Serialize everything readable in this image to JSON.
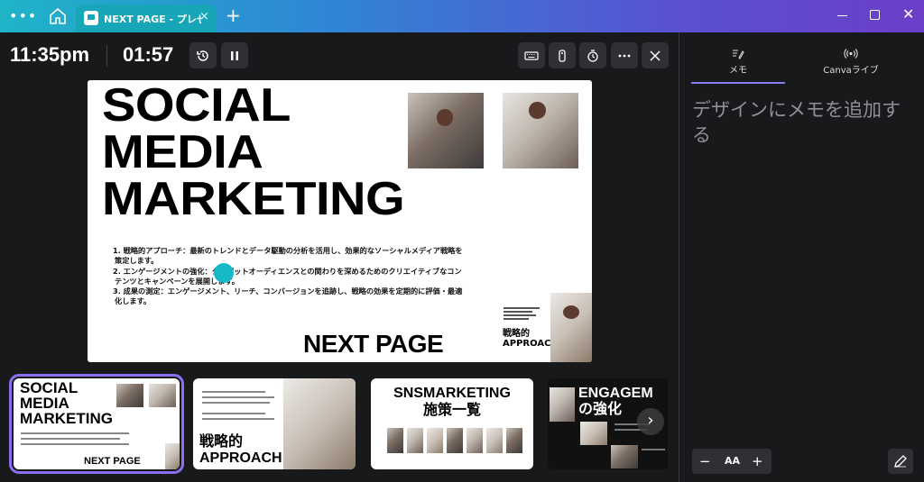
{
  "titlebar": {
    "tab_title": "NEXT PAGE - プレゼン",
    "tab_close": "×",
    "new_tab": "+",
    "more": "•••",
    "close": "✕"
  },
  "presenter": {
    "clock": "11:35pm",
    "timer": "01:57"
  },
  "slide": {
    "title_lines": [
      "SOCIAL",
      "MEDIA",
      "MARKETING"
    ],
    "list": [
      "1. 戦略的アプローチ：最新のトレンドとデータ駆動の分析を活用し、効果的なソーシャルメディア戦略を",
      "策定します。",
      "2. エンゲージメントの強化：ターゲットオーディエンスとの関わりを深めるためのクリエイティブなコン",
      "テンツとキャンペーンを展開します。",
      "3. 成果の測定：エンゲージメント、リーチ、コンバージョンを追跡し、戦略の効果を定期的に評価・最適",
      "化します。"
    ],
    "footer": "NEXT PAGE",
    "approach_jp": "戦略的",
    "approach_en": "APPROACH"
  },
  "right_panel": {
    "tab_notes": "メモ",
    "tab_live": "Canvaライブ",
    "notes_placeholder": "デザインにメモを追加する",
    "zoom_minus": "−",
    "zoom_label": "AA",
    "zoom_plus": "+"
  },
  "thumbnails": [
    {
      "title": [
        "SOCIAL",
        "MEDIA",
        "MARKETING"
      ],
      "footer": "NEXT PAGE"
    },
    {
      "title": [
        "戦略的",
        "APPROACH"
      ]
    },
    {
      "title": [
        "SNSMARKETING",
        "施策一覧"
      ]
    },
    {
      "title": [
        "ENGAGEM",
        "の強化"
      ]
    }
  ],
  "colors": {
    "accent": "#8b6ff0",
    "tab": "#17a5b8",
    "laser": "#16b9c7",
    "bg": "#18191b"
  },
  "icons": [
    "home-icon",
    "history-icon",
    "pause-icon",
    "keyboard-icon",
    "remote-icon",
    "timer-icon",
    "more-icon",
    "close-icon",
    "pencil-icon",
    "broadcast-icon",
    "edit-icon",
    "chevron-right-icon"
  ]
}
